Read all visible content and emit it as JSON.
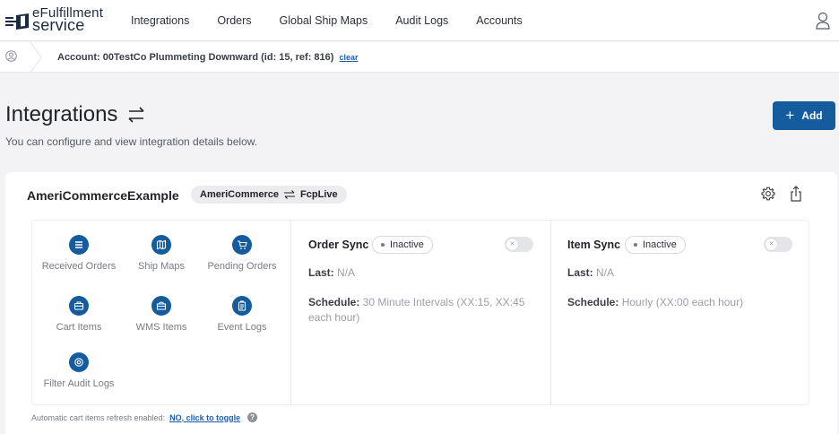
{
  "brand": {
    "line1": "eFulfillment",
    "line2": "service"
  },
  "nav": {
    "items": [
      {
        "label": "Integrations"
      },
      {
        "label": "Orders"
      },
      {
        "label": "Global Ship Maps"
      },
      {
        "label": "Audit Logs"
      },
      {
        "label": "Accounts"
      }
    ]
  },
  "account_bar": {
    "text": "Account: 00TestCo Plummeting Downward (id: 15, ref: 816)",
    "clear_label": "clear"
  },
  "page": {
    "title": "Integrations",
    "subtitle": "You can configure and view integration details below.",
    "add_label": "Add"
  },
  "integration": {
    "name": "AmeriCommerceExample",
    "source": "AmeriCommerce",
    "target": "FcpLive",
    "tiles": [
      {
        "label": "Received Orders",
        "icon": "list-icon"
      },
      {
        "label": "Ship Maps",
        "icon": "map-icon"
      },
      {
        "label": "Pending Orders",
        "icon": "cart-icon"
      },
      {
        "label": "Cart Items",
        "icon": "briefcase-icon"
      },
      {
        "label": "WMS Items",
        "icon": "box-icon"
      },
      {
        "label": "Event Logs",
        "icon": "clipboard-icon"
      },
      {
        "label": "Filter Audit Logs",
        "icon": "search-icon"
      }
    ],
    "order_sync": {
      "title": "Order Sync",
      "status": "Inactive",
      "last_label": "Last:",
      "last_value": "N/A",
      "schedule_label": "Schedule:",
      "schedule_value": "30 Minute Intervals (XX:15, XX:45 each hour)"
    },
    "item_sync": {
      "title": "Item Sync",
      "status": "Inactive",
      "last_label": "Last:",
      "last_value": "N/A",
      "schedule_label": "Schedule:",
      "schedule_value": "Hourly (XX:00 each hour)"
    },
    "refresh_note": "Automatic cart items refresh enabled:",
    "refresh_toggle_label": "NO, click to toggle",
    "help_glyph": "?"
  },
  "colors": {
    "primary": "#145c9e",
    "background": "#f3f3f5"
  }
}
